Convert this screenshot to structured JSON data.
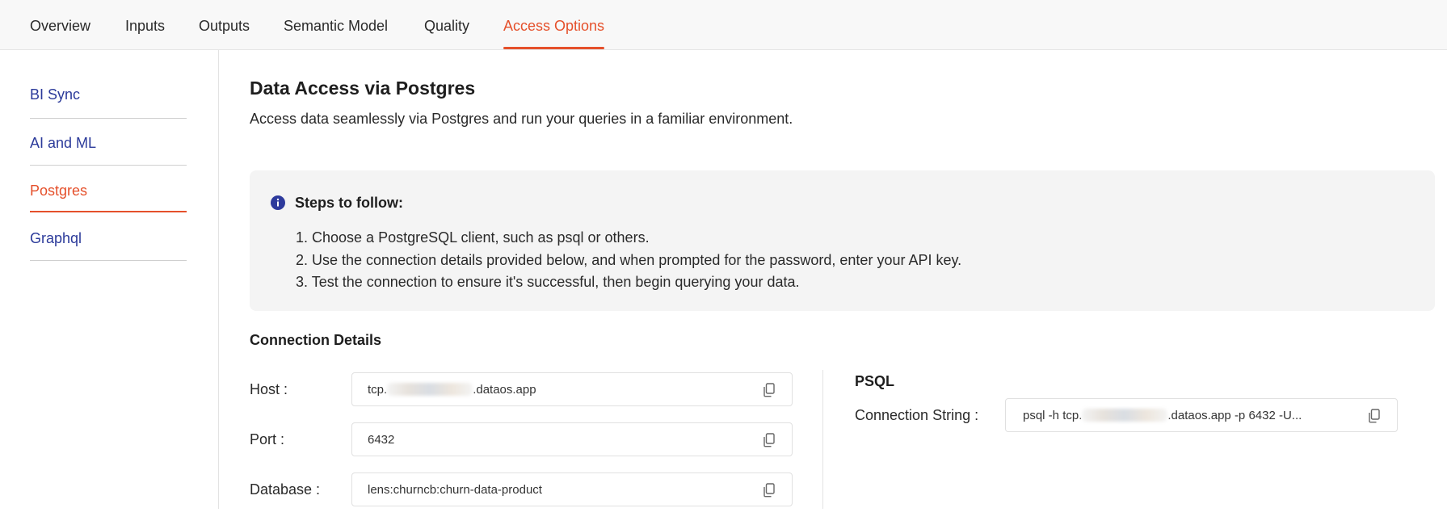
{
  "tabs": [
    {
      "label": "Overview"
    },
    {
      "label": "Inputs"
    },
    {
      "label": "Outputs"
    },
    {
      "label": "Semantic Model"
    },
    {
      "label": "Quality"
    },
    {
      "label": "Access Options",
      "active": true
    }
  ],
  "sidebar": {
    "items": [
      {
        "label": "BI Sync"
      },
      {
        "label": "AI and ML"
      },
      {
        "label": "Postgres",
        "active": true
      },
      {
        "label": "Graphql"
      }
    ]
  },
  "main": {
    "title": "Data Access via Postgres",
    "subtitle": "Access data seamlessly via Postgres and run your queries in a familiar environment.",
    "steps": {
      "icon": "info-icon",
      "heading": "Steps to follow:",
      "items": [
        "1. Choose a PostgreSQL client, such as psql or others.",
        "2. Use the connection details provided below, and when prompted for the password, enter your API key.",
        "3. Test the connection to ensure it's successful, then begin querying your data."
      ]
    },
    "connection": {
      "heading": "Connection Details",
      "host": {
        "label": "Host :",
        "value_prefix": "tcp.",
        "value_suffix": ".dataos.app"
      },
      "port": {
        "label": "Port :",
        "value": "6432"
      },
      "database": {
        "label": "Database :",
        "value": "lens:churncb:churn-data-product"
      }
    },
    "psql": {
      "heading": "PSQL",
      "label": "Connection String :",
      "value_prefix": "psql -h tcp.",
      "value_suffix": ".dataos.app -p 6432 -U..."
    }
  },
  "colors": {
    "accent": "#e5502b",
    "link": "#2b3a9a",
    "info": "#2d3a9c",
    "panel": "#f4f4f4"
  }
}
